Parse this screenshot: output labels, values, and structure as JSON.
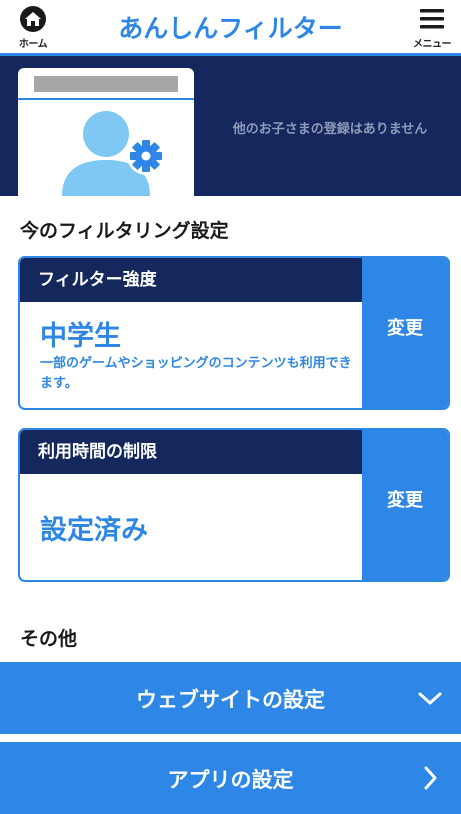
{
  "header": {
    "home_label": "ホーム",
    "title": "あんしんフィルター",
    "menu_label": "メニュー"
  },
  "profile": {
    "no_other_children": "他のお子さまの登録はありません"
  },
  "current_settings": {
    "heading": "今のフィルタリング設定",
    "filter_strength": {
      "label": "フィルター強度",
      "value": "中学生",
      "description": "一部のゲームやショッピングのコンテンツも利用できます。",
      "change_label": "変更"
    },
    "time_limit": {
      "label": "利用時間の制限",
      "value": "設定済み",
      "change_label": "変更"
    }
  },
  "other": {
    "heading": "その他",
    "website_settings": "ウェブサイトの設定",
    "app_settings": "アプリの設定"
  },
  "colors": {
    "accent": "#2e86e6",
    "navy": "#14285e",
    "avatar": "#7fc8f4"
  },
  "icons": {
    "home": "home-icon",
    "menu": "hamburger-menu-icon",
    "avatar": "user-avatar-icon",
    "gear": "gear-icon",
    "expand": "chevron-down-icon",
    "go": "chevron-right-icon"
  }
}
